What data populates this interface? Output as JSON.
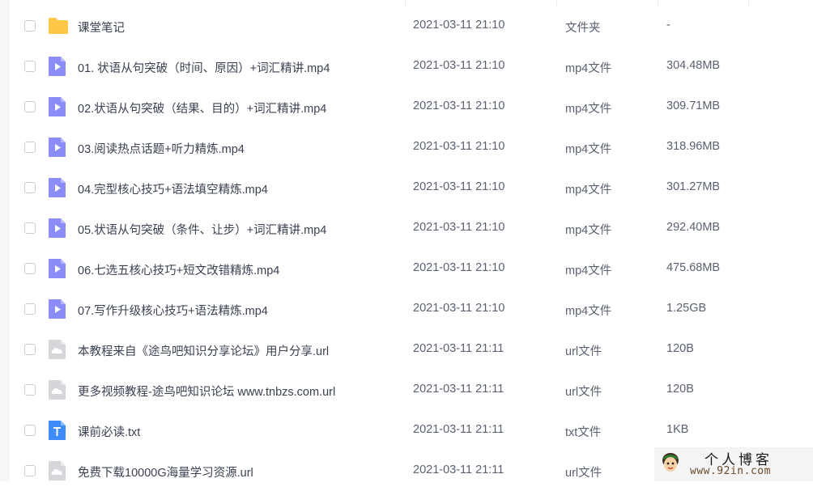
{
  "files": [
    {
      "name": "课堂笔记",
      "date": "2021-03-11 21:10",
      "type": "文件夹",
      "size": "-",
      "icon": "folder-icon"
    },
    {
      "name": "01. 状语从句突破（时间、原因）+词汇精讲.mp4",
      "date": "2021-03-11 21:10",
      "type": "mp4文件",
      "size": "304.48MB",
      "icon": "video-file-icon"
    },
    {
      "name": "02.状语从句突破（结果、目的）+词汇精讲.mp4",
      "date": "2021-03-11 21:10",
      "type": "mp4文件",
      "size": "309.71MB",
      "icon": "video-file-icon"
    },
    {
      "name": "03.阅读热点话题+听力精炼.mp4",
      "date": "2021-03-11 21:10",
      "type": "mp4文件",
      "size": "318.96MB",
      "icon": "video-file-icon"
    },
    {
      "name": "04.完型核心技巧+语法填空精炼.mp4",
      "date": "2021-03-11 21:10",
      "type": "mp4文件",
      "size": "301.27MB",
      "icon": "video-file-icon"
    },
    {
      "name": "05.状语从句突破（条件、让步）+词汇精讲.mp4",
      "date": "2021-03-11 21:10",
      "type": "mp4文件",
      "size": "292.40MB",
      "icon": "video-file-icon"
    },
    {
      "name": "06.七选五核心技巧+短文改错精炼.mp4",
      "date": "2021-03-11 21:10",
      "type": "mp4文件",
      "size": "475.68MB",
      "icon": "video-file-icon"
    },
    {
      "name": "07.写作升级核心技巧+语法精炼.mp4",
      "date": "2021-03-11 21:10",
      "type": "mp4文件",
      "size": "1.25GB",
      "icon": "video-file-icon"
    },
    {
      "name": "本教程来自《途鸟吧知识分享论坛》用户分享.url",
      "date": "2021-03-11 21:11",
      "type": "url文件",
      "size": "120B",
      "icon": "cloud-file-icon"
    },
    {
      "name": "更多视频教程-途鸟吧知识论坛 www.tnbzs.com.url",
      "date": "2021-03-11 21:11",
      "type": "url文件",
      "size": "120B",
      "icon": "cloud-file-icon"
    },
    {
      "name": "课前必读.txt",
      "date": "2021-03-11 21:11",
      "type": "txt文件",
      "size": "1KB",
      "icon": "text-file-icon"
    },
    {
      "name": "免费下载10000G海量学习资源.url",
      "date": "2021-03-11 21:11",
      "type": "url文件",
      "size": "",
      "icon": "cloud-file-icon"
    }
  ],
  "watermark": {
    "title": "个人博客",
    "url": "www.92in.com"
  },
  "colors": {
    "folder": "#ffc746",
    "video": "#8b8cf7",
    "text": "#3d8cf7",
    "cloud": "#d4d6da"
  }
}
